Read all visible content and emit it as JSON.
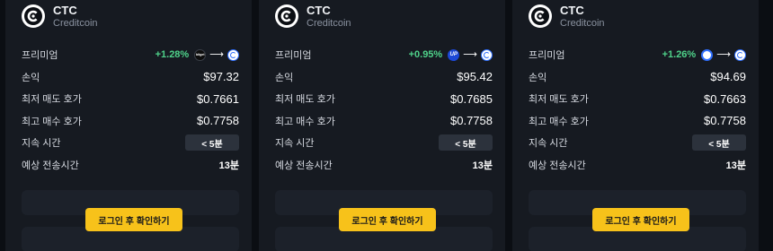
{
  "cards": [
    {
      "symbol": "CTC",
      "name": "Creditcoin",
      "premium_label": "프리미엄",
      "premium_value": "+1.28%",
      "source_exchange_icon": "bitget-icon",
      "profit_label": "손익",
      "profit_value": "$97.32",
      "lowest_ask_label": "최저 매도 호가",
      "lowest_ask_value": "$0.7661",
      "highest_bid_label": "최고 매수 호가",
      "highest_bid_value": "$0.7758",
      "duration_label": "지속 시간",
      "duration_value": "< 5분",
      "transfer_label": "예상 전송시간",
      "transfer_value": "13분",
      "login_button": "로그인 후 확인하기"
    },
    {
      "symbol": "CTC",
      "name": "Creditcoin",
      "premium_label": "프리미엄",
      "premium_value": "+0.95%",
      "source_exchange_icon": "upbit-icon",
      "profit_label": "손익",
      "profit_value": "$95.42",
      "lowest_ask_label": "최저 매도 호가",
      "lowest_ask_value": "$0.7685",
      "highest_bid_label": "최고 매수 호가",
      "highest_bid_value": "$0.7758",
      "duration_label": "지속 시간",
      "duration_value": "< 5분",
      "transfer_label": "예상 전송시간",
      "transfer_value": "13분",
      "login_button": "로그인 후 확인하기"
    },
    {
      "symbol": "CTC",
      "name": "Creditcoin",
      "premium_label": "프리미엄",
      "premium_value": "+1.26%",
      "source_exchange_icon": "coinone-icon",
      "profit_label": "손익",
      "profit_value": "$94.69",
      "lowest_ask_label": "최저 매도 호가",
      "lowest_ask_value": "$0.7663",
      "highest_bid_label": "최고 매수 호가",
      "highest_bid_value": "$0.7758",
      "duration_label": "지속 시간",
      "duration_value": "< 5분",
      "transfer_label": "예상 전송시간",
      "transfer_value": "13분",
      "login_button": "로그인 후 확인하기"
    }
  ],
  "colors": {
    "background": "#0b0e13",
    "card": "#161a21",
    "premium_green": "#4fd28a",
    "login_yellow": "#f7c21a",
    "pill": "#2c323c"
  }
}
